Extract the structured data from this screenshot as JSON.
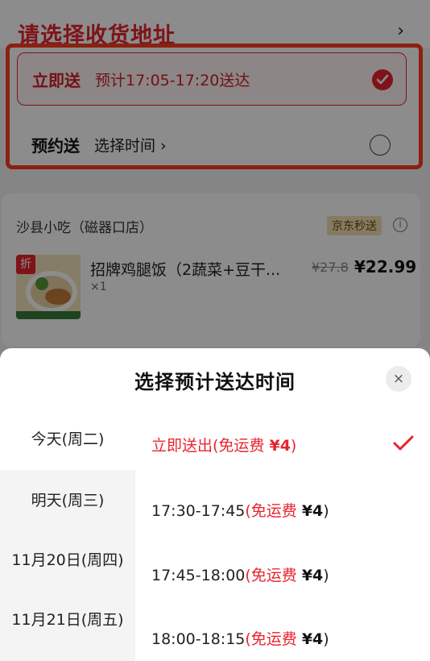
{
  "address": {
    "title": "请选择收货地址",
    "chevron": "›"
  },
  "delivery": {
    "now_label": "立即送",
    "now_time": "预计17:05-17:20送达",
    "later_label": "预约送",
    "later_time": "选择时间 ›"
  },
  "shop": {
    "name": "沙县小吃（磁器口店）",
    "badge": "京东秒送",
    "item_tag": "折",
    "item_name": "招牌鸡腿饭（2蔬菜+豆干...",
    "item_qty": "×1",
    "price_old": "¥27.8",
    "price_new": "¥22.99"
  },
  "sheet": {
    "title": "选择预计送达时间",
    "close_icon": "×",
    "days": [
      {
        "label": "今天(周二)"
      },
      {
        "label": "明天(周三)"
      },
      {
        "label": "11月20日(周四)"
      },
      {
        "label": "11月21日(周五)"
      }
    ],
    "slots": [
      {
        "time": "立即送出",
        "fee": "(免运费 ",
        "price": "¥4",
        "close": ")"
      },
      {
        "time": "17:30-17:45",
        "fee": "(免运费 ",
        "price": "¥4",
        "close": ")"
      },
      {
        "time": "17:45-18:00",
        "fee": "(免运费 ",
        "price": "¥4",
        "close": ")"
      },
      {
        "time": "18:00-18:15",
        "fee": "(免运费 ",
        "price": "¥4",
        "close": ")"
      }
    ]
  },
  "colors": {
    "accent": "#e8242f",
    "highlight_border": "#ff3b1f"
  }
}
